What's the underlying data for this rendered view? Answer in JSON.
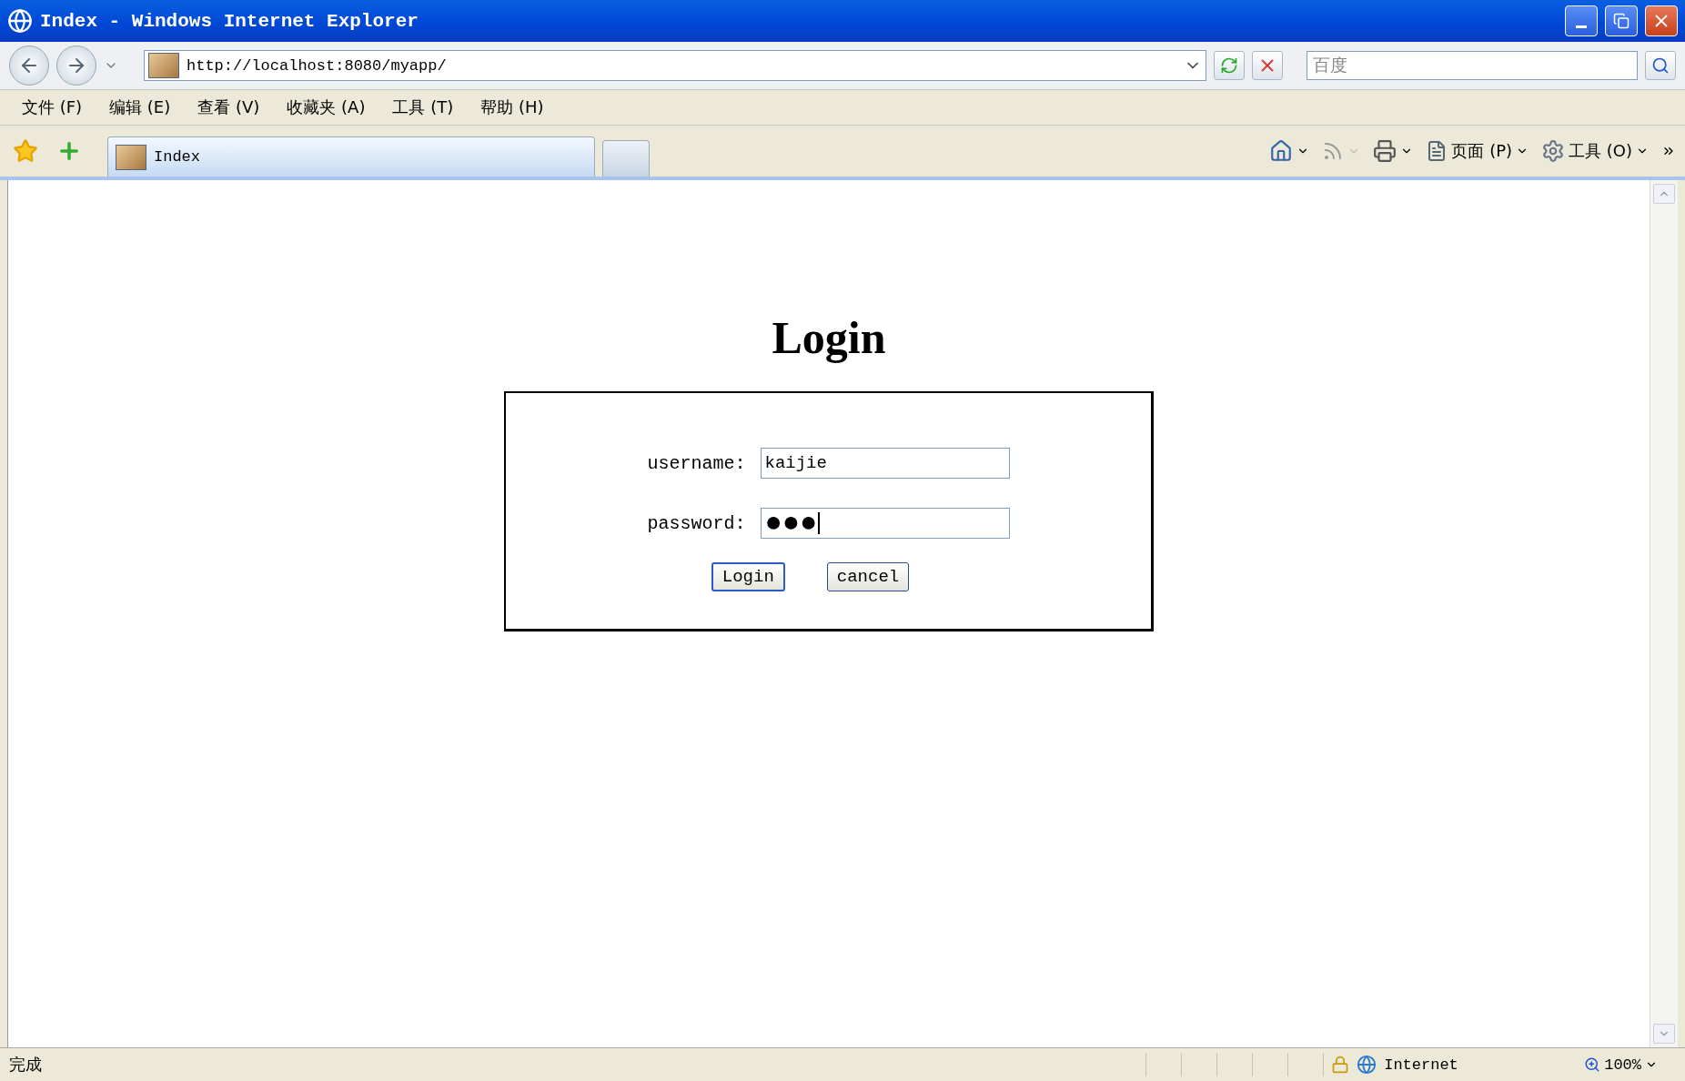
{
  "window": {
    "title": "Index - Windows Internet Explorer"
  },
  "address_bar": {
    "url": "http://localhost:8080/myapp/"
  },
  "search": {
    "placeholder": "百度"
  },
  "menu": [
    "文件 (F)",
    "编辑 (E)",
    "查看 (V)",
    "收藏夹 (A)",
    "工具 (T)",
    "帮助 (H)"
  ],
  "tabs": [
    {
      "label": "Index",
      "selected": true
    }
  ],
  "command_bar": {
    "page": "页面 (P)",
    "tools": "工具 (O)"
  },
  "page": {
    "heading": "Login",
    "fields": [
      {
        "label": "username:",
        "value": "kaijie",
        "kind": "text"
      },
      {
        "label": "password:",
        "value": "●●●",
        "kind": "password"
      }
    ],
    "buttons": [
      {
        "label": "Login",
        "focused": true
      },
      {
        "label": "cancel",
        "focused": false
      }
    ]
  },
  "status_bar": {
    "status": "完成",
    "zone": "Internet",
    "zoom": "100%"
  }
}
